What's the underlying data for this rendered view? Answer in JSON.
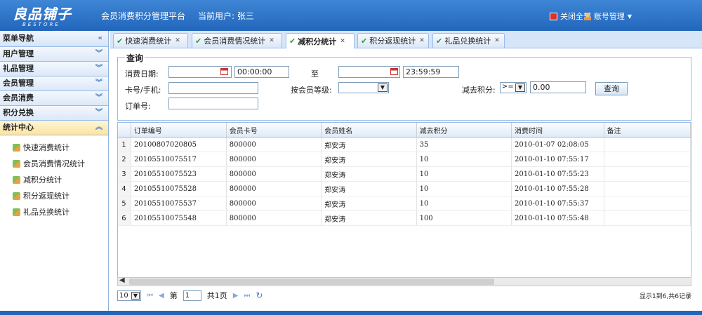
{
  "header": {
    "logo": "良品铺子",
    "logo_sub": "BESTORE",
    "app_title": "会员消费积分管理平台",
    "current_user": "当前用户: 张三",
    "close_all": "关闭全部",
    "account": "账号管理"
  },
  "nav": {
    "title": "菜单导航",
    "groups": [
      "用户管理",
      "礼品管理",
      "会员管理",
      "会员消费",
      "积分兑换",
      "统计中心"
    ],
    "items": [
      "快速消费统计",
      "会员消费情况统计",
      "减积分统计",
      "积分返现统计",
      "礼品兑换统计"
    ]
  },
  "tabs": [
    {
      "label": "快速消费统计"
    },
    {
      "label": "会员消费情况统计"
    },
    {
      "label": "减积分统计"
    },
    {
      "label": "积分返现统计"
    },
    {
      "label": "礼品兑换统计"
    }
  ],
  "query": {
    "legend": "查询",
    "date_label": "消费日期:",
    "start_time": "00:00:00",
    "to_label": "至",
    "end_time": "23:59:59",
    "card_label": "卡号/手机:",
    "level_label": "按会员等级:",
    "points_label": "减去积分:",
    "operator": ">=",
    "points_value": "0.00",
    "order_label": "订单号:",
    "query_button": "查询"
  },
  "grid": {
    "columns": [
      "订单编号",
      "会员卡号",
      "会员姓名",
      "减去积分",
      "消费时间",
      "备注"
    ],
    "rows": [
      [
        "1",
        "20100807020805",
        "800000",
        "郑安涛",
        "35",
        "2010-01-07 02:08:05",
        ""
      ],
      [
        "2",
        "20105510075517",
        "800000",
        "郑安涛",
        "10",
        "2010-01-10 07:55:17",
        ""
      ],
      [
        "3",
        "20105510075523",
        "800000",
        "郑安涛",
        "10",
        "2010-01-10 07:55:23",
        ""
      ],
      [
        "4",
        "20105510075528",
        "800000",
        "郑安涛",
        "10",
        "2010-01-10 07:55:28",
        ""
      ],
      [
        "5",
        "20105510075537",
        "800000",
        "郑安涛",
        "10",
        "2010-01-10 07:55:37",
        ""
      ],
      [
        "6",
        "20105510075548",
        "800000",
        "郑安涛",
        "100",
        "2010-01-10 07:55:48",
        ""
      ]
    ]
  },
  "pager": {
    "page_size": "10",
    "page_prefix": "第",
    "page_value": "1",
    "page_suffix": "共1页",
    "info": "显示1到6,共6记录"
  }
}
